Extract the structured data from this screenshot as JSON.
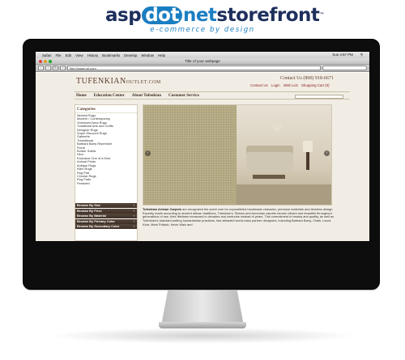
{
  "brand": {
    "asp": "asp",
    "dot": "dot",
    "net": "net",
    "storefront": "storefront",
    "tm": "™",
    "tagline": "e-commerce by design"
  },
  "os_menu": {
    "apple": "",
    "items": [
      "Safari",
      "File",
      "Edit",
      "View",
      "History",
      "Bookmarks",
      "Develop",
      "Window",
      "Help"
    ],
    "clock": "Sun 4:57 PM"
  },
  "browser": {
    "window_title": "Title of your webpage",
    "url": "http://www.url.com"
  },
  "site": {
    "logo_main": "TUFENKIAN",
    "logo_small": "OUTLET.COM",
    "contact": "Contact Us (800) 918-6671",
    "util_links": [
      "Contact Us",
      "Login",
      "Wish List",
      "Shopping Cart (0)"
    ],
    "nav": [
      "Home",
      "Education Center",
      "About Tufenkian",
      "Customer Service"
    ],
    "sidebar_title": "Categories",
    "categories": [
      "Newest Rugs",
      "Modern / Contemporary",
      "Oversized Area Rugs",
      "Traditional Arts and Crafts",
      "Designer Rugs",
      "Super Discount Rugs",
      "Gabbehs",
      "Transitional",
      "Barbara Barry Repertoire",
      "Floral",
      "Border Solids",
      "Herz",
      "Exclusive One of a Kind",
      "Animal Prints",
      "Antique Rugs",
      "Kilim Rugs",
      "Rug Pad",
      "Circular Rugs",
      "Rug Pads",
      "Featured"
    ],
    "browse": [
      "Browse By Size",
      "Browse By Price",
      "Browse By Material",
      "Browse By Primary Color",
      "Browse By Secondary Color"
    ],
    "intro_bold": "Tufenkian Artisan Carpets",
    "intro_text": "are recognized the world over for unparalleled handmade character, premium materials and timeless design. Expertly made according to ancient artisan traditions, Tufenkian's Tibetan and Armenian carpets remain vibrant and beautiful throughout generations of use, their lifetimes measured in decades and centuries instead of years. This commitment to beauty and quality, as well as Tufenkian's standard-setting humanitarian practices, has attracted world-class partner designers, including Barbara Barry, Chalk, Laura Kirar, Mark Pollack, Kevin Walz and"
  }
}
